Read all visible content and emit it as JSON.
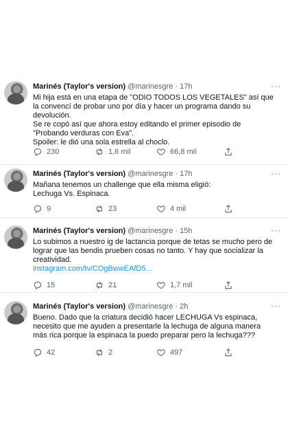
{
  "tweets": [
    {
      "name": "Marinés (Taylor's version)",
      "handle": "@marinesgre",
      "time": "17h",
      "text": [
        "Mi hija está en una etapa de \"ODIO TODOS LOS VEGETALES\" así que la convencí de probar uno por día y hacer un programa dando su devolución.",
        "Se re copó así que ahora estoy editando el primer episodio de \"Probando verduras con Eva\".",
        "Spoiler: le dió una sola estrella al choclo."
      ],
      "link": "",
      "replies": "230",
      "retweets": "1,6 mil",
      "likes": "66,8 mil"
    },
    {
      "name": "Marinés (Taylor's version)",
      "handle": "@marinesgre",
      "time": "17h",
      "text": [
        "Mañana tenemos un challenge que ella misma eligió:",
        "Lechuga Vs. Espinaca."
      ],
      "link": "",
      "replies": "9",
      "retweets": "23",
      "likes": "4 mil"
    },
    {
      "name": "Marinés (Taylor's version)",
      "handle": "@marinesgre",
      "time": "15h",
      "text": [
        "Lo subimos a nuestro ig de lactancia porque de tetas se mucho pero de lograr que las bendis prueben cosas no tanto. Y hay que socializar la creatividad."
      ],
      "link": "instagram.com/tv/COgBwwEAfD5...",
      "replies": "15",
      "retweets": "21",
      "likes": "1,7 mil"
    },
    {
      "name": "Marinés (Taylor's version)",
      "handle": "@marinesgre",
      "time": "2h",
      "text": [
        "Bueno. Dado que la criatura decidió hacer LECHUGA Vs espinaca, necesito que me ayuden a presentarle la lechuga de alguna manera más rica porque la espinaca la puedo preparar pero la lechuga???"
      ],
      "link": "",
      "replies": "42",
      "retweets": "2",
      "likes": "497"
    }
  ]
}
